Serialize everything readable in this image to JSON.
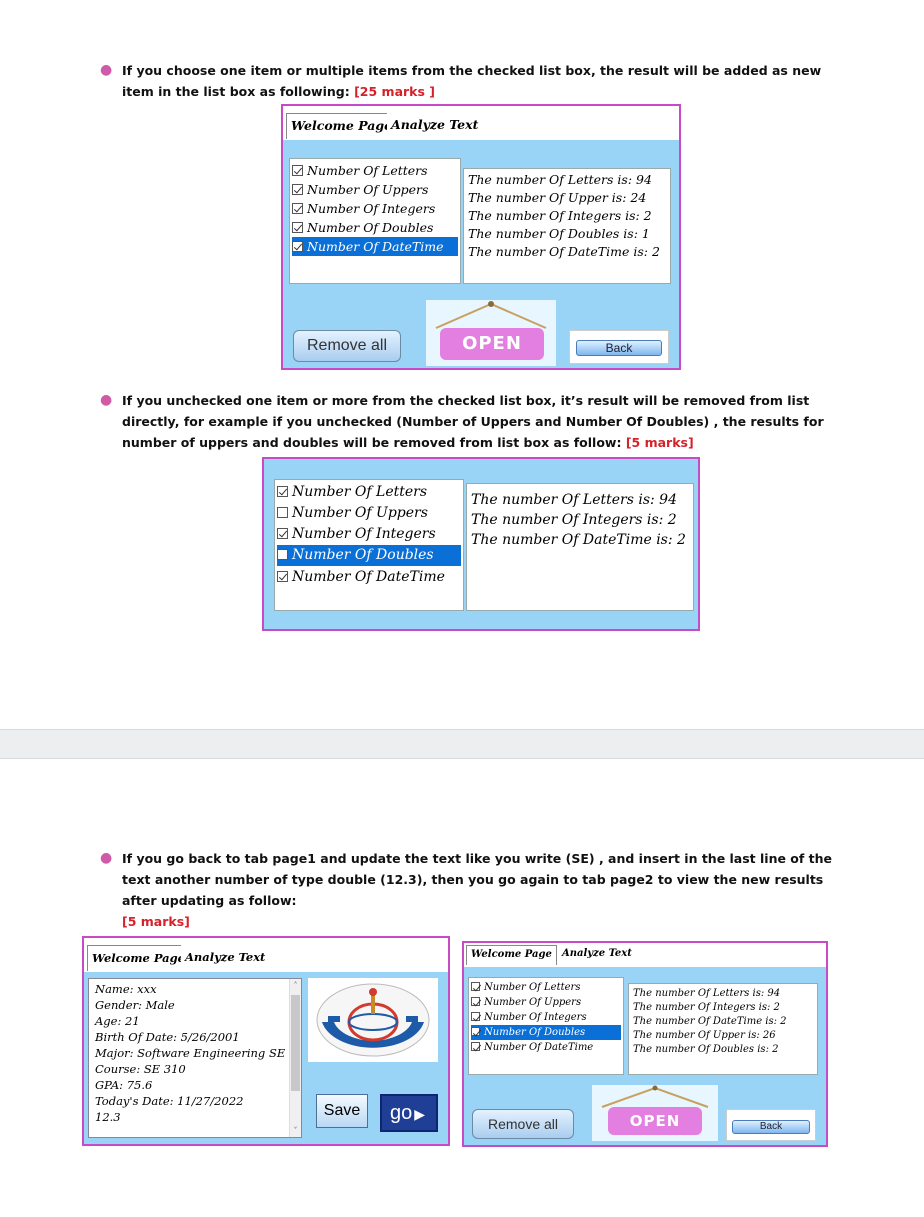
{
  "section1": {
    "text": "If you choose one item or multiple items from the checked list box, the result will be added as new item in the list box as following:",
    "marks": "[25 marks ]"
  },
  "section2": {
    "text": "If you unchecked one item or more from the checked list box, it’s result will be removed from list directly, for example if  you unchecked  (Number of Uppers and Number Of Doubles) , the results for number of uppers and doubles will be removed from list box as follow:",
    "marks": "[5 marks]"
  },
  "section3": {
    "text": "If you go back to tab page1 and update the text like you write (SE) , and insert in the last line of the text another number of type double (12.3), then you go again to tab page2 to view the new results after updating as follow:",
    "marks": "[5 marks]"
  },
  "tabs": {
    "welcome": "Welcome Page",
    "analyze": "Analyze Text"
  },
  "buttons": {
    "remove_all": "Remove all",
    "open": "OPEN",
    "back": "Back",
    "save": "Save",
    "go": "go"
  },
  "app1": {
    "checklist": [
      {
        "label": "Number Of Letters",
        "checked": true,
        "selected": false
      },
      {
        "label": "Number Of Uppers",
        "checked": true,
        "selected": false
      },
      {
        "label": "Number Of Integers",
        "checked": true,
        "selected": false
      },
      {
        "label": "Number Of Doubles",
        "checked": true,
        "selected": false
      },
      {
        "label": "Number Of DateTime",
        "checked": true,
        "selected": true
      }
    ],
    "results": [
      "The number Of Letters is: 94",
      "The number Of Upper is: 24",
      "The number Of Integers is: 2",
      "The number Of Doubles is: 1",
      "The number Of DateTime is: 2"
    ]
  },
  "app2": {
    "checklist": [
      {
        "label": "Number Of Letters",
        "checked": true,
        "selected": false
      },
      {
        "label": "Number Of Uppers",
        "checked": false,
        "selected": false
      },
      {
        "label": "Number Of Integers",
        "checked": true,
        "selected": false
      },
      {
        "label": "Number Of Doubles",
        "checked": false,
        "selected": true
      },
      {
        "label": "Number Of DateTime",
        "checked": true,
        "selected": false
      }
    ],
    "results": [
      "The number Of Letters is: 94",
      "The number Of Integers is: 2",
      "The number Of DateTime is: 2"
    ]
  },
  "app3": {
    "lines": [
      "Name: xxx",
      "Gender: Male",
      "Age: 21",
      "Birth Of Date: 5/26/2001",
      "Major: Software Engineering SE",
      "Course: SE 310",
      "GPA: 75.6",
      "Today's Date: 11/27/2022",
      "12.3"
    ]
  },
  "app4": {
    "checklist": [
      {
        "label": "Number Of Letters",
        "checked": true,
        "selected": false
      },
      {
        "label": "Number Of Uppers",
        "checked": true,
        "selected": false
      },
      {
        "label": "Number Of Integers",
        "checked": true,
        "selected": false
      },
      {
        "label": "Number Of Doubles",
        "checked": true,
        "selected": true
      },
      {
        "label": "Number Of DateTime",
        "checked": true,
        "selected": false
      }
    ],
    "results": [
      "The number Of Letters is: 94",
      "The number Of Integers is: 2",
      "The number Of DateTime is: 2",
      "The number Of Upper is: 26",
      "The number Of Doubles is: 2"
    ]
  },
  "colors": {
    "window_border": "#c84bc6",
    "tab_body": "#99d3f5",
    "selection": "#0a6fd6",
    "open_button": "#e27fe0",
    "marks": "#d6202a"
  }
}
